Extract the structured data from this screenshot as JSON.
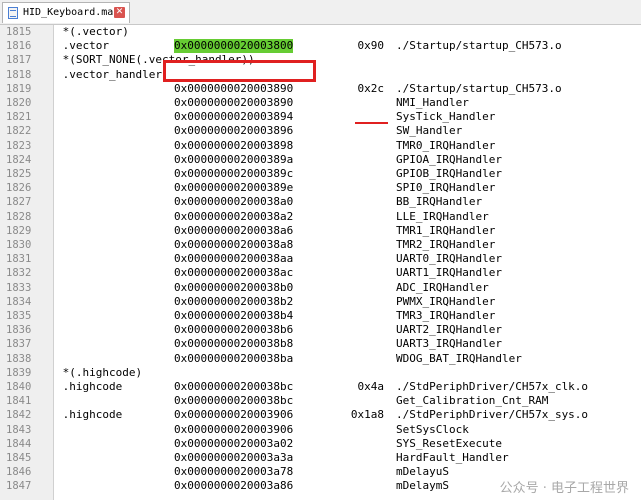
{
  "tab": {
    "title": "HID_Keyboard.map",
    "close_icon": "close-icon",
    "file_icon": "map-file-icon"
  },
  "accent": {
    "highlight": "#66cc33",
    "annotation": "#e02020"
  },
  "lines": [
    {
      "num": "1815",
      "c1": " *(.vector)",
      "c2": "",
      "c3": "",
      "c4": ""
    },
    {
      "num": "1816",
      "c1": " .vector",
      "c2": "0x0000000020003800",
      "c3": "0x90",
      "c4": "./Startup/startup_CH573.o"
    },
    {
      "num": "1817",
      "c1": " *(SORT_NONE(.vector_handler))",
      "c2": "",
      "c3": "",
      "c4": ""
    },
    {
      "num": "1818",
      "c1": " .vector_handler",
      "c2": "",
      "c3": "",
      "c4": ""
    },
    {
      "num": "1819",
      "c1": "",
      "c2": "0x0000000020003890",
      "c3": "0x2c",
      "c4": "./Startup/startup_CH573.o"
    },
    {
      "num": "1820",
      "c1": "",
      "c2": "0x0000000020003890",
      "c3": "",
      "c4": "NMI_Handler"
    },
    {
      "num": "1821",
      "c1": "",
      "c2": "0x0000000020003894",
      "c3": "",
      "c4": "SysTick_Handler"
    },
    {
      "num": "1822",
      "c1": "",
      "c2": "0x0000000020003896",
      "c3": "",
      "c4": "SW_Handler"
    },
    {
      "num": "1823",
      "c1": "",
      "c2": "0x0000000020003898",
      "c3": "",
      "c4": "TMR0_IRQHandler"
    },
    {
      "num": "1824",
      "c1": "",
      "c2": "0x000000002000389a",
      "c3": "",
      "c4": "GPIOA_IRQHandler"
    },
    {
      "num": "1825",
      "c1": "",
      "c2": "0x000000002000389c",
      "c3": "",
      "c4": "GPIOB_IRQHandler"
    },
    {
      "num": "1826",
      "c1": "",
      "c2": "0x000000002000389e",
      "c3": "",
      "c4": "SPI0_IRQHandler"
    },
    {
      "num": "1827",
      "c1": "",
      "c2": "0x00000000200038a0",
      "c3": "",
      "c4": "BB_IRQHandler"
    },
    {
      "num": "1828",
      "c1": "",
      "c2": "0x00000000200038a2",
      "c3": "",
      "c4": "LLE_IRQHandler"
    },
    {
      "num": "1829",
      "c1": "",
      "c2": "0x00000000200038a6",
      "c3": "",
      "c4": "TMR1_IRQHandler"
    },
    {
      "num": "1830",
      "c1": "",
      "c2": "0x00000000200038a8",
      "c3": "",
      "c4": "TMR2_IRQHandler"
    },
    {
      "num": "1831",
      "c1": "",
      "c2": "0x00000000200038aa",
      "c3": "",
      "c4": "UART0_IRQHandler"
    },
    {
      "num": "1832",
      "c1": "",
      "c2": "0x00000000200038ac",
      "c3": "",
      "c4": "UART1_IRQHandler"
    },
    {
      "num": "1833",
      "c1": "",
      "c2": "0x00000000200038b0",
      "c3": "",
      "c4": "ADC_IRQHandler"
    },
    {
      "num": "1834",
      "c1": "",
      "c2": "0x00000000200038b2",
      "c3": "",
      "c4": "PWMX_IRQHandler"
    },
    {
      "num": "1835",
      "c1": "",
      "c2": "0x00000000200038b4",
      "c3": "",
      "c4": "TMR3_IRQHandler"
    },
    {
      "num": "1836",
      "c1": "",
      "c2": "0x00000000200038b6",
      "c3": "",
      "c4": "UART2_IRQHandler"
    },
    {
      "num": "1837",
      "c1": "",
      "c2": "0x00000000200038b8",
      "c3": "",
      "c4": "UART3_IRQHandler"
    },
    {
      "num": "1838",
      "c1": "",
      "c2": "0x00000000200038ba",
      "c3": "",
      "c4": "WDOG_BAT_IRQHandler"
    },
    {
      "num": "1839",
      "c1": " *(.highcode)",
      "c2": "",
      "c3": "",
      "c4": ""
    },
    {
      "num": "1840",
      "c1": " .highcode",
      "c2": "0x00000000200038bc",
      "c3": "0x4a",
      "c4": "./StdPeriphDriver/CH57x_clk.o"
    },
    {
      "num": "1841",
      "c1": "",
      "c2": "0x00000000200038bc",
      "c3": "",
      "c4": "Get_Calibration_Cnt_RAM"
    },
    {
      "num": "1842",
      "c1": " .highcode",
      "c2": "0x0000000020003906",
      "c3": "0x1a8",
      "c4": "./StdPeriphDriver/CH57x_sys.o"
    },
    {
      "num": "1843",
      "c1": "",
      "c2": "0x0000000020003906",
      "c3": "",
      "c4": "SetSysClock"
    },
    {
      "num": "1844",
      "c1": "",
      "c2": "0x0000000020003a02",
      "c3": "",
      "c4": "SYS_ResetExecute"
    },
    {
      "num": "1845",
      "c1": "",
      "c2": "0x0000000020003a3a",
      "c3": "",
      "c4": "HardFault_Handler"
    },
    {
      "num": "1846",
      "c1": "",
      "c2": "0x0000000020003a78",
      "c3": "",
      "c4": "mDelayuS"
    },
    {
      "num": "1847",
      "c1": "",
      "c2": "0x0000000020003a86",
      "c3": "",
      "c4": "mDelaymS"
    }
  ],
  "watermark": "公众号 · 电子工程世界"
}
